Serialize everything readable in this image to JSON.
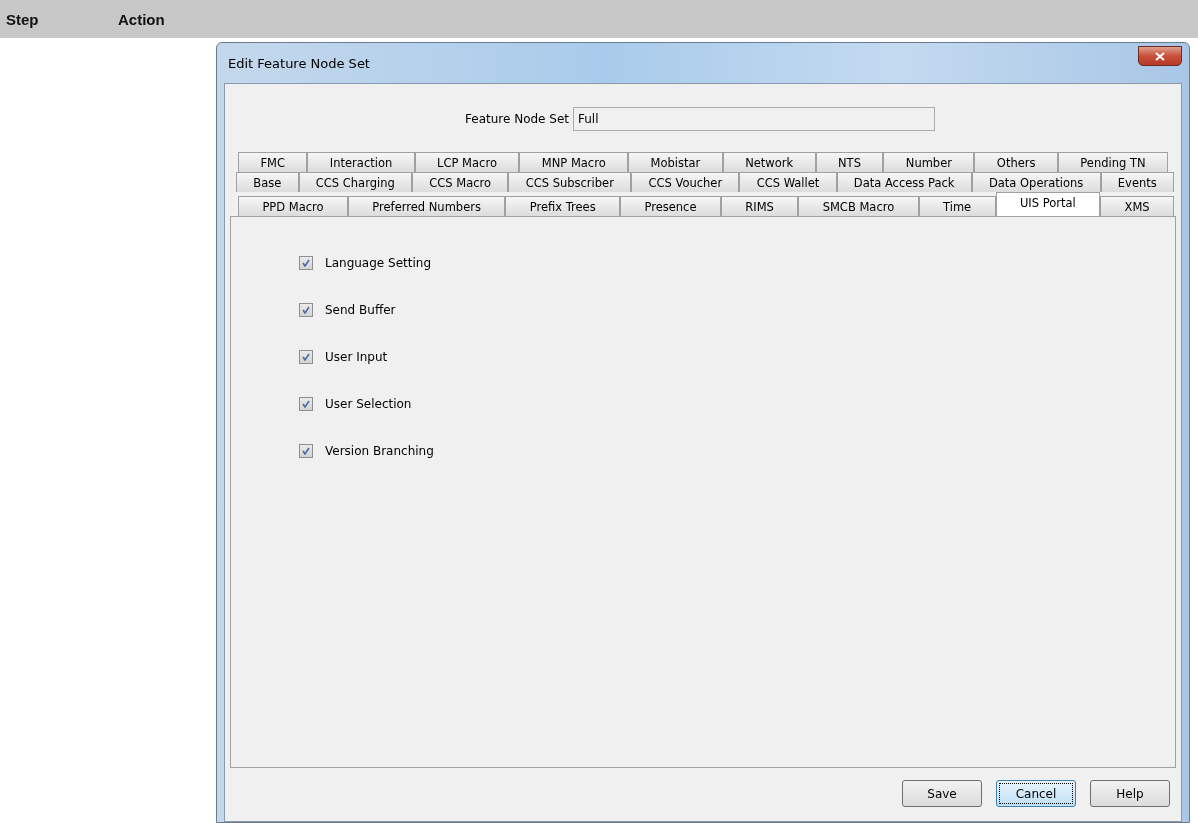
{
  "header": {
    "columns": [
      "Step",
      "Action"
    ]
  },
  "window": {
    "title": "Edit Feature Node Set"
  },
  "feature_node_set": {
    "label": "Feature Node Set",
    "value": "Full"
  },
  "tab_rows": [
    [
      {
        "label": "FMC",
        "selected": false
      },
      {
        "label": "Interaction",
        "selected": false
      },
      {
        "label": "LCP Macro",
        "selected": false
      },
      {
        "label": "MNP Macro",
        "selected": false
      },
      {
        "label": "Mobistar",
        "selected": false
      },
      {
        "label": "Network",
        "selected": false
      },
      {
        "label": "NTS",
        "selected": false
      },
      {
        "label": "Number",
        "selected": false
      },
      {
        "label": "Others",
        "selected": false
      },
      {
        "label": "Pending TN",
        "selected": false
      }
    ],
    [
      {
        "label": "Base",
        "selected": false
      },
      {
        "label": "CCS Charging",
        "selected": false
      },
      {
        "label": "CCS Macro",
        "selected": false
      },
      {
        "label": "CCS Subscriber",
        "selected": false
      },
      {
        "label": "CCS Voucher",
        "selected": false
      },
      {
        "label": "CCS Wallet",
        "selected": false
      },
      {
        "label": "Data Access Pack",
        "selected": false
      },
      {
        "label": "Data Operations",
        "selected": false
      },
      {
        "label": "Events",
        "selected": false
      }
    ],
    [
      {
        "label": "PPD Macro",
        "selected": false
      },
      {
        "label": "Preferred Numbers",
        "selected": false
      },
      {
        "label": "Prefix Trees",
        "selected": false
      },
      {
        "label": "Presence",
        "selected": false
      },
      {
        "label": "RIMS",
        "selected": false
      },
      {
        "label": "SMCB Macro",
        "selected": false
      },
      {
        "label": "Time",
        "selected": false
      },
      {
        "label": "UIS Portal",
        "selected": true
      },
      {
        "label": "XMS",
        "selected": false
      }
    ]
  ],
  "features": [
    {
      "label": "Language Setting",
      "checked": true
    },
    {
      "label": "Send Buffer",
      "checked": true
    },
    {
      "label": "User Input",
      "checked": true
    },
    {
      "label": "User Selection",
      "checked": true
    },
    {
      "label": "Version Branching",
      "checked": true
    }
  ],
  "buttons": [
    {
      "label": "Save",
      "focused": false
    },
    {
      "label": "Cancel",
      "focused": true
    },
    {
      "label": "Help",
      "focused": false
    }
  ]
}
